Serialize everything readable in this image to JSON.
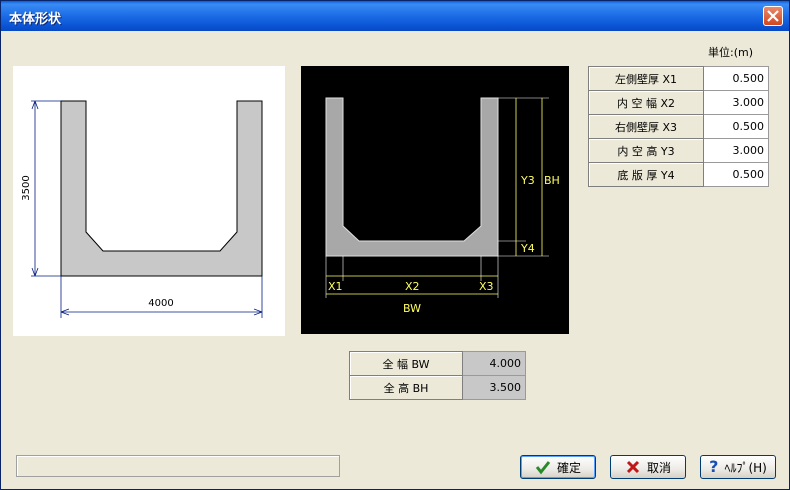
{
  "window": {
    "title": "本体形状"
  },
  "units_label": "単位:(m)",
  "diagram_left": {
    "height_dim": "3500",
    "width_dim": "4000"
  },
  "diagram_right": {
    "labels": {
      "y3": "Y3",
      "bh": "BH",
      "y4": "Y4",
      "x1": "X1",
      "x2": "X2",
      "x3": "X3",
      "bw": "BW"
    },
    "colors": {
      "shape": "#c0c0c0",
      "dim": "#ffff60",
      "bg": "#000000"
    }
  },
  "params": [
    {
      "label": "左側壁厚 X1",
      "value": "0.500"
    },
    {
      "label": "内 空 幅 X2",
      "value": "3.000"
    },
    {
      "label": "右側壁厚 X3",
      "value": "0.500"
    },
    {
      "label": "内 空 高 Y3",
      "value": "3.000"
    },
    {
      "label": "底 版 厚 Y4",
      "value": "0.500"
    }
  ],
  "totals": [
    {
      "label": "全  幅  BW",
      "value": "4.000"
    },
    {
      "label": "全  高  BH",
      "value": "3.500"
    }
  ],
  "buttons": {
    "ok": "確定",
    "cancel": "取消",
    "help": "ﾍﾙﾌﾟ(H)"
  }
}
